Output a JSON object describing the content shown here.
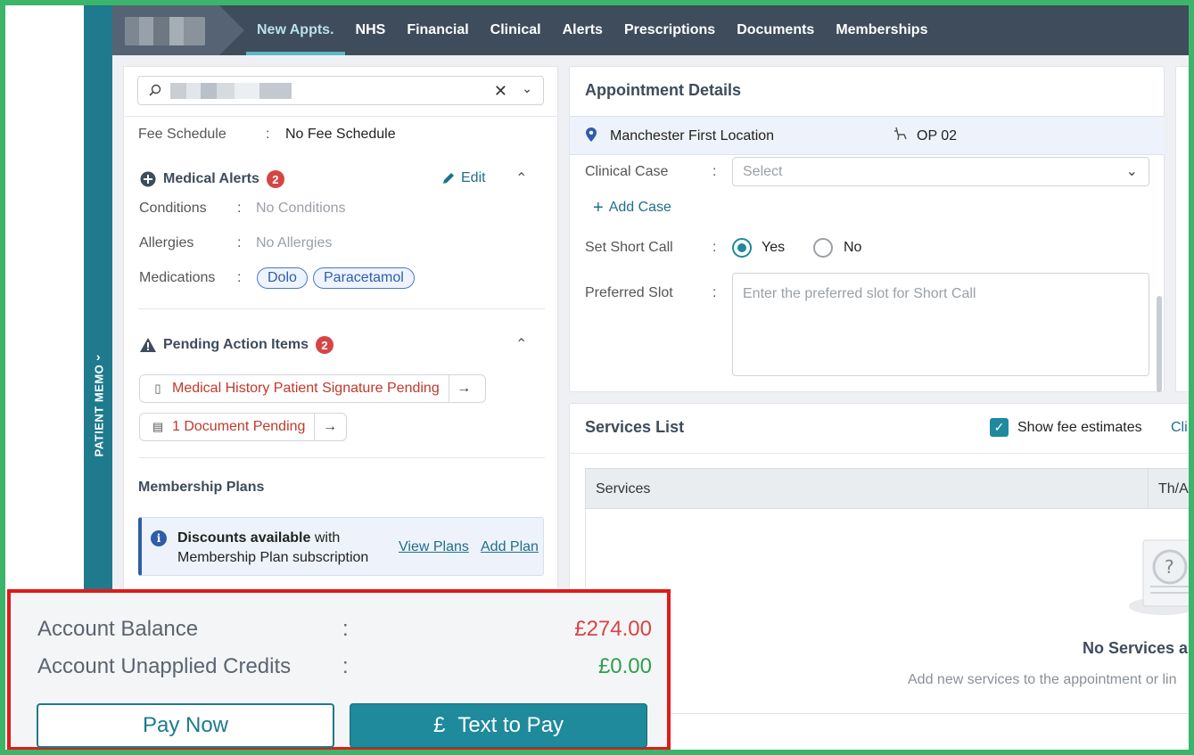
{
  "colors": {
    "accent": "#1e8a9c",
    "nav_bg": "#3e4c5b",
    "memo_strip": "#1e7a8c",
    "balance_negative": "#d64545",
    "balance_positive": "#2e9e4f",
    "alert_badge": "#d64545",
    "highlight_border": "#e01b1b"
  },
  "sidebar": {
    "memo_label": "PATIENT MEMO"
  },
  "nav": {
    "items": [
      {
        "label": "New Appts.",
        "active": true
      },
      {
        "label": "NHS"
      },
      {
        "label": "Financial"
      },
      {
        "label": "Clinical"
      },
      {
        "label": "Alerts"
      },
      {
        "label": "Prescriptions"
      },
      {
        "label": "Documents"
      },
      {
        "label": "Memberships"
      }
    ]
  },
  "patient": {
    "fee_schedule_label": "Fee Schedule",
    "fee_schedule_value": "No Fee Schedule",
    "medical_alerts": {
      "title": "Medical Alerts",
      "count": "2",
      "edit_label": "Edit",
      "conditions_label": "Conditions",
      "conditions_value": "No Conditions",
      "allergies_label": "Allergies",
      "allergies_value": "No Allergies",
      "medications_label": "Medications",
      "medications": [
        "Dolo",
        "Paracetamol"
      ]
    },
    "pending": {
      "title": "Pending Action Items",
      "count": "2",
      "items": [
        {
          "label": "Medical History Patient Signature Pending",
          "icon": "clipboard-icon"
        },
        {
          "label": "1 Document Pending",
          "icon": "document-icon"
        }
      ]
    },
    "membership": {
      "title": "Membership Plans",
      "info_bold": "Discounts available",
      "info_rest": " with Membership Plan subscription",
      "view_plans": "View Plans",
      "add_plan": "Add Plan"
    }
  },
  "appointment": {
    "title": "Appointment Details",
    "location": "Manchester First Location",
    "chair": "OP 02",
    "clinical_case_label": "Clinical Case",
    "clinical_case_placeholder": "Select",
    "add_case": "Add Case",
    "short_call_label": "Set Short Call",
    "short_call_yes": "Yes",
    "short_call_no": "No",
    "short_call_selected": "Yes",
    "preferred_slot_label": "Preferred Slot",
    "preferred_slot_placeholder": "Enter the preferred slot for Short Call"
  },
  "services": {
    "title": "Services List",
    "show_fee_label": "Show fee estimates",
    "show_fee_checked": true,
    "cli_link": "Cli",
    "col_services": "Services",
    "col_th": "Th/A",
    "empty_title": "No Services a",
    "empty_sub": "Add new services to the appointment or lin"
  },
  "account": {
    "balance_label": "Account Balance",
    "balance_value": "£274.00",
    "credits_label": "Account Unapplied Credits",
    "credits_value": "£0.00",
    "pay_now": "Pay Now",
    "text_to_pay": "Text to Pay",
    "text_to_pay_symbol": "£"
  }
}
